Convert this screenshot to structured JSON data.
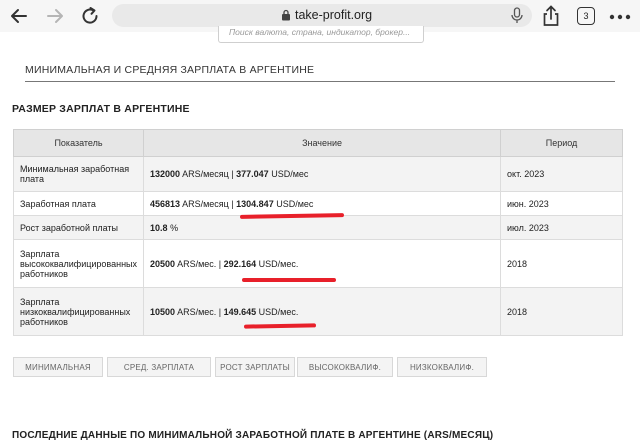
{
  "browser": {
    "url": "take-profit.org",
    "tab_count": "3",
    "icons": [
      "back-icon",
      "forward-icon",
      "reload-icon",
      "lock-icon",
      "microphone-icon",
      "share-icon",
      "tabs-icon",
      "more-icon"
    ]
  },
  "search": {
    "placeholder": "Поиск валюта, страна, индикатор, брокер..."
  },
  "section": {
    "title": "МИНИМАЛЬНАЯ И СРЕДНЯЯ ЗАРПЛАТА В АРГЕНТИНЕ"
  },
  "table_section": {
    "title": "РАЗМЕР ЗАРПЛАТ В АРГЕНТИНЕ",
    "headers": [
      "Показатель",
      "Значение",
      "Период"
    ],
    "rows": [
      {
        "indicator": "Минимальная заработная плата",
        "v1": "132000",
        "u1": " ARS/месяц | ",
        "v2": "377.047",
        "u2": " USD/мес",
        "period": "окт. 2023"
      },
      {
        "indicator": "Заработная плата",
        "v1": "456813",
        "u1": " ARS/месяц | ",
        "v2": "1304.847",
        "u2": " USD/мес",
        "period": "июн. 2023"
      },
      {
        "indicator": "Рост заработной платы",
        "v1": "10.8",
        "u1": " %",
        "v2": "",
        "u2": "",
        "period": "июл. 2023"
      },
      {
        "indicator": "Зарплата высококвалифицированных работников",
        "v1": "20500",
        "u1": " ARS/мес. | ",
        "v2": "292.164",
        "u2": " USD/мес.",
        "period": "2018"
      },
      {
        "indicator": "Зарплата низкоквалифицированных работников",
        "v1": "10500",
        "u1": " ARS/мес. | ",
        "v2": "149.645",
        "u2": " USD/мес.",
        "period": "2018"
      }
    ],
    "highlight_color": "#e8202a"
  },
  "chart_tabs": [
    "МИНИМАЛЬНАЯ",
    "СРЕД. ЗАРПЛАТА",
    "РОСТ ЗАРПЛАТЫ",
    "ВЫСОКОКВАЛИФ.",
    "НИЗКОКВАЛИФ."
  ],
  "latest": {
    "title": "ПОСЛЕДНИЕ ДАННЫЕ ПО МИНИМАЛЬНОЙ ЗАРАБОТНОЙ ПЛАТЕ В АРГЕНТИНЕ (ARS/МЕСЯЦ)"
  }
}
